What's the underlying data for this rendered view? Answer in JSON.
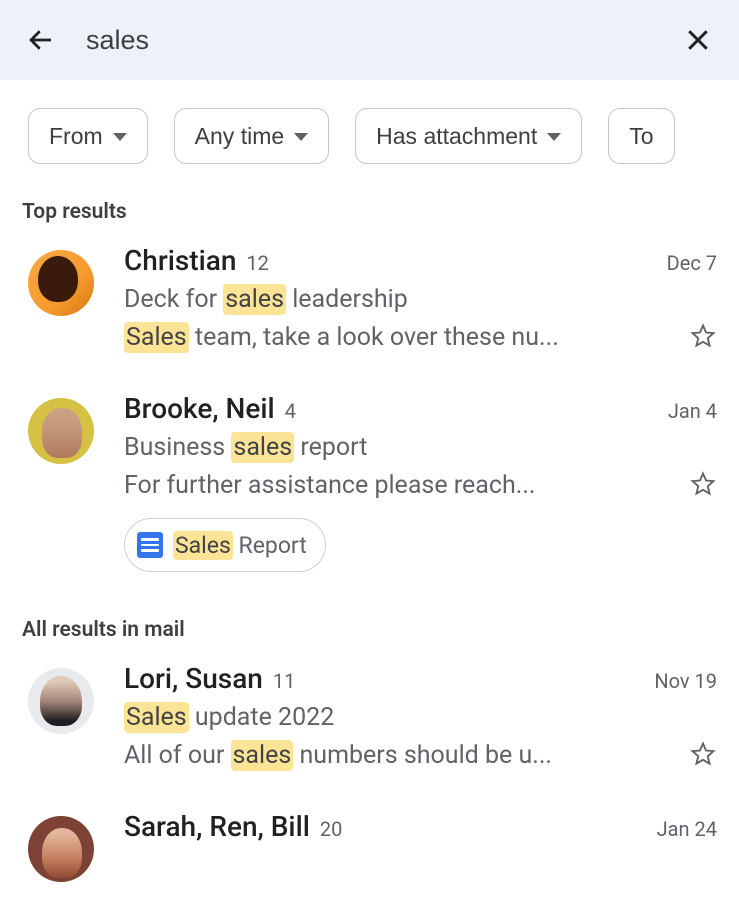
{
  "search": {
    "query": "sales"
  },
  "filters": {
    "from": "From",
    "anytime": "Any time",
    "has_attachment": "Has attachment",
    "to": "To"
  },
  "section_top": "Top results",
  "section_all": "All results in mail",
  "results": [
    {
      "sender": "Christian",
      "count": "12",
      "date": "Dec 7",
      "subject_pre": "Deck for ",
      "subject_hl": "sales",
      "subject_post": " leadership",
      "snippet_hl": "Sales",
      "snippet_post": " team, take a look over these nu..."
    },
    {
      "sender": "Brooke, Neil",
      "count": "4",
      "date": "Jan 4",
      "subject_pre": "Business ",
      "subject_hl": "sales",
      "subject_post": " report",
      "snippet_pre": "For further assistance please reach...",
      "attachment_hl": "Sales",
      "attachment_post": " Report"
    },
    {
      "sender": "Lori, Susan",
      "count": "11",
      "date": "Nov 19",
      "subject_hl": "Sales",
      "subject_post": "  update 2022",
      "snippet_pre": "All of our ",
      "snippet_hl": "sales",
      "snippet_post": " numbers should be u..."
    },
    {
      "sender": "Sarah, Ren, Bill",
      "count": "20",
      "date": "Jan 24"
    }
  ]
}
